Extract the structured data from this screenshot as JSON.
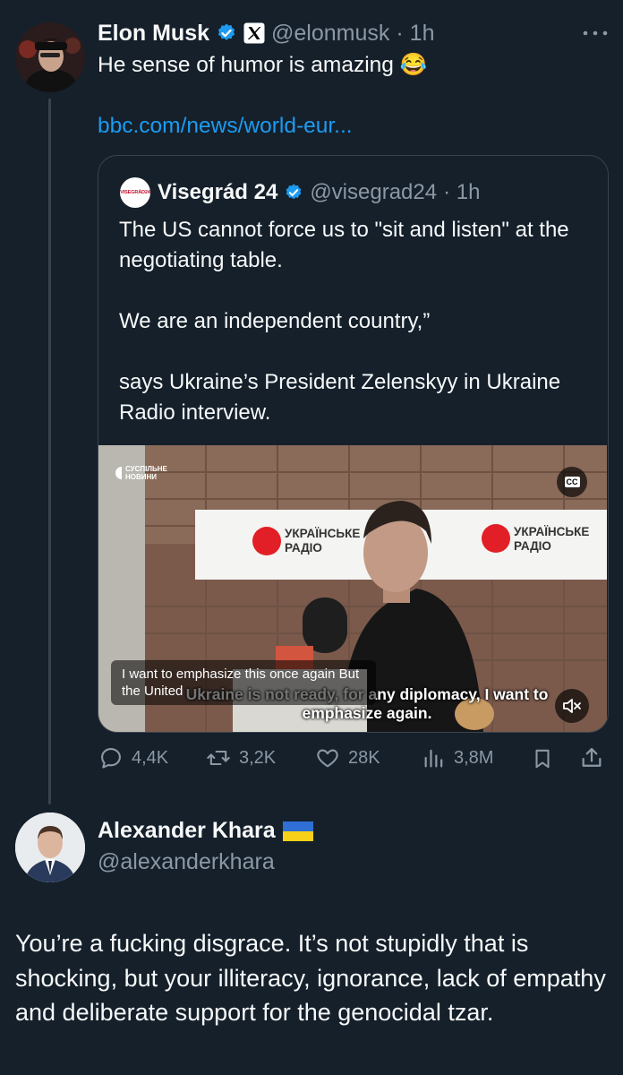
{
  "tweet": {
    "author_name": "Elon Musk",
    "handle": "@elonmusk",
    "time": "· 1h",
    "text": "He sense of humor is amazing 😂",
    "link": "bbc.com/news/world-eur...",
    "more_icon": "ellipsis-icon"
  },
  "quote": {
    "author_name": "Visegrád 24",
    "handle": "@visegrad24",
    "time": "· 1h",
    "avatar_label": "VISEGRÁD24",
    "text": "The US cannot force us to \"sit and listen\" at the negotiating table.\n\nWe are an independent country,”\n\nsays Ukraine’s President Zelenskyy in Ukraine Radio interview.",
    "video": {
      "broadcaster_logo": "СУСПІЛЬНЕ\nНОВИНИ",
      "sign_left": "УКРАЇНСЬКЕ\nРАДІО",
      "sign_right": "УКРАЇНСЬКЕ\nРАДІО",
      "cc_label": "CC",
      "caption": "I want to emphasize this once again But the United",
      "burned_subtitle_line1": "Ukraine is not ready, for any diplomacy, I want to",
      "burned_subtitle_line2": "emphasize again.",
      "mute_icon": "speaker-muted-icon"
    }
  },
  "actions": {
    "replies": "4,4K",
    "reposts": "3,2K",
    "likes": "28K",
    "views": "3,8M"
  },
  "reply": {
    "author_name": "Alexander Khara",
    "flag": "🇺🇦",
    "handle": "@alexanderkhara",
    "text": "You’re a fucking disgrace. It’s not stupidly that is shocking, but your illiteracy, ignorance, lack of empathy and deliberate support for the genocidal tzar."
  },
  "colors": {
    "background": "#15202b",
    "text": "#f7f9f9",
    "muted": "#8b98a5",
    "link": "#1d9bf0",
    "verified": "#1d9bf0",
    "border": "#38444d"
  }
}
